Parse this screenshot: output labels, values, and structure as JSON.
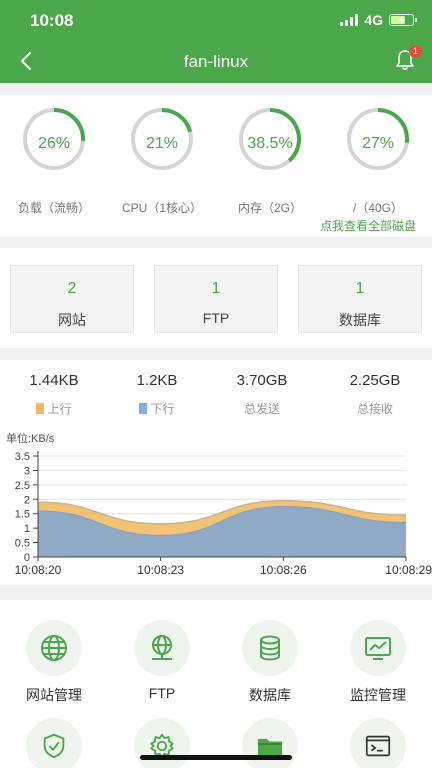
{
  "status_bar": {
    "time": "10:08",
    "network": "4G"
  },
  "header": {
    "title": "fan-linux",
    "notification_count": "1"
  },
  "gauges": [
    {
      "value": "26%",
      "label": "负载（流畅）",
      "percent": 26
    },
    {
      "value": "21%",
      "label": "CPU（1核心）",
      "percent": 21
    },
    {
      "value": "38.5%",
      "label": "内存（2G）",
      "percent": 38.5
    },
    {
      "value": "27%",
      "label": "/（40G）",
      "percent": 27
    }
  ],
  "disk_link": "点我查看全部磁盘",
  "counts": [
    {
      "value": "2",
      "label": "网站"
    },
    {
      "value": "1",
      "label": "FTP"
    },
    {
      "value": "1",
      "label": "数据库"
    }
  ],
  "traffic": [
    {
      "value": "1.44KB",
      "label": "上行"
    },
    {
      "value": "1.2KB",
      "label": "下行"
    },
    {
      "value": "3.70GB",
      "label": "总发送"
    },
    {
      "value": "2.25GB",
      "label": "总接收"
    }
  ],
  "chart_unit": "单位:KB/s",
  "chart_data": {
    "type": "area",
    "x": [
      "10:08:20",
      "10:08:23",
      "10:08:26",
      "10:08:29"
    ],
    "series": [
      {
        "name": "上行",
        "values": [
          1.9,
          1.15,
          1.95,
          1.45
        ]
      },
      {
        "name": "下行",
        "values": [
          1.6,
          0.75,
          1.75,
          1.2
        ]
      }
    ],
    "y_ticks": [
      "0",
      "0.5",
      "1",
      "1.5",
      "2",
      "2.5",
      "3",
      "3.5"
    ],
    "ylim": [
      0,
      3.5
    ]
  },
  "colors": {
    "primary": "#4aa84a",
    "upload": "#f0b95e",
    "download": "#8aa8c8",
    "gauge_track": "#d4d4d4"
  },
  "menu": [
    {
      "label": "网站管理",
      "icon": "globe-icon"
    },
    {
      "label": "FTP",
      "icon": "ftp-globe-icon"
    },
    {
      "label": "数据库",
      "icon": "database-icon"
    },
    {
      "label": "监控管理",
      "icon": "monitor-chart-icon"
    },
    {
      "label": "",
      "icon": "shield-check-icon"
    },
    {
      "label": "",
      "icon": "gear-icon"
    },
    {
      "label": "",
      "icon": "folder-icon"
    },
    {
      "label": "",
      "icon": "terminal-icon"
    }
  ]
}
